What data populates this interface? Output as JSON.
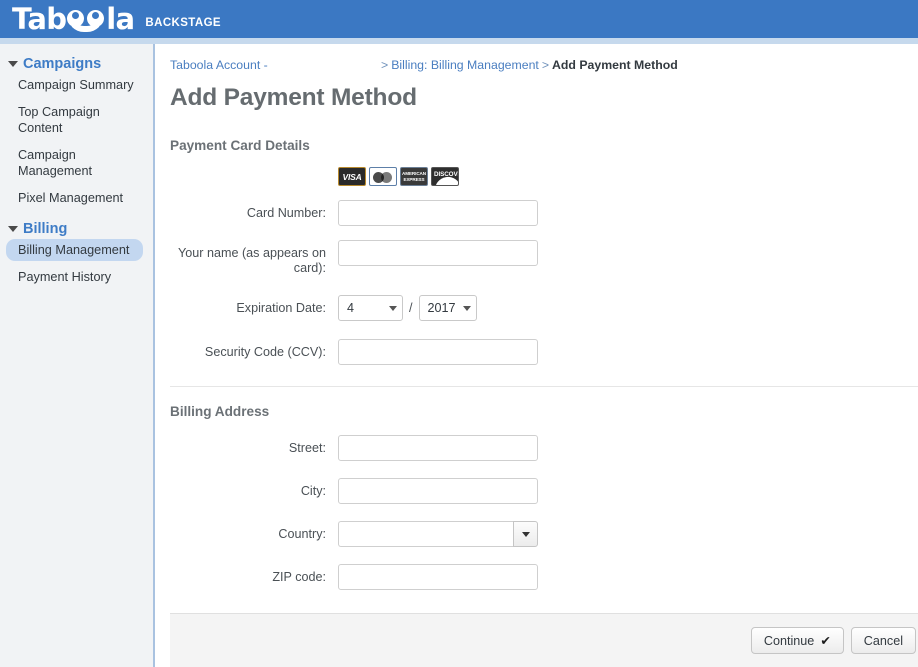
{
  "header": {
    "logo_text_1": "Tab",
    "logo_text_2": "la",
    "logo_subtitle": "BACKSTAGE",
    "brand_color": "#3b78c3"
  },
  "sidebar": {
    "groups": [
      {
        "label": "Campaigns",
        "items": [
          {
            "label": "Campaign Summary",
            "selected": false
          },
          {
            "label": "Top Campaign Content",
            "selected": false
          },
          {
            "label": "Campaign Management",
            "selected": false
          },
          {
            "label": "Pixel Management",
            "selected": false
          }
        ]
      },
      {
        "label": "Billing",
        "items": [
          {
            "label": "Billing Management",
            "selected": true
          },
          {
            "label": "Payment History",
            "selected": false
          }
        ]
      }
    ],
    "selected_highlight_color": "#c3d7f0"
  },
  "breadcrumb": {
    "account": "Taboola Account -",
    "separator_1": ">",
    "link_1": "Billing: Billing Management",
    "separator_2": ">",
    "current": "Add Payment Method"
  },
  "page": {
    "title": "Add Payment Method"
  },
  "card_section": {
    "title": "Payment Card Details",
    "accepted_cards": [
      "VISA",
      "MasterCard",
      "AMERICAN EXPRESS",
      "DISCOVER"
    ],
    "card_logo_labels": {
      "visa": "VISA",
      "amex_line1": "AMERICAN",
      "amex_line2": "EXPRESS",
      "discover": "DISC",
      "discover_full": "DISCOVER"
    },
    "fields": {
      "card_number_label": "Card Number:",
      "card_number_value": "",
      "name_label": "Your name (as appears on card):",
      "name_value": "",
      "expiration_label": "Expiration Date:",
      "expiration_month": "4",
      "expiration_separator": "/",
      "expiration_year": "2017",
      "ccv_label": "Security Code (CCV):",
      "ccv_value": ""
    }
  },
  "billing_section": {
    "title": "Billing Address",
    "fields": {
      "street_label": "Street:",
      "street_value": "",
      "city_label": "City:",
      "city_value": "",
      "country_label": "Country:",
      "country_value": "",
      "zip_label": "ZIP code:",
      "zip_value": ""
    }
  },
  "footer": {
    "continue_label": "Continue",
    "continue_icon": "check-mark",
    "cancel_label": "Cancel"
  }
}
